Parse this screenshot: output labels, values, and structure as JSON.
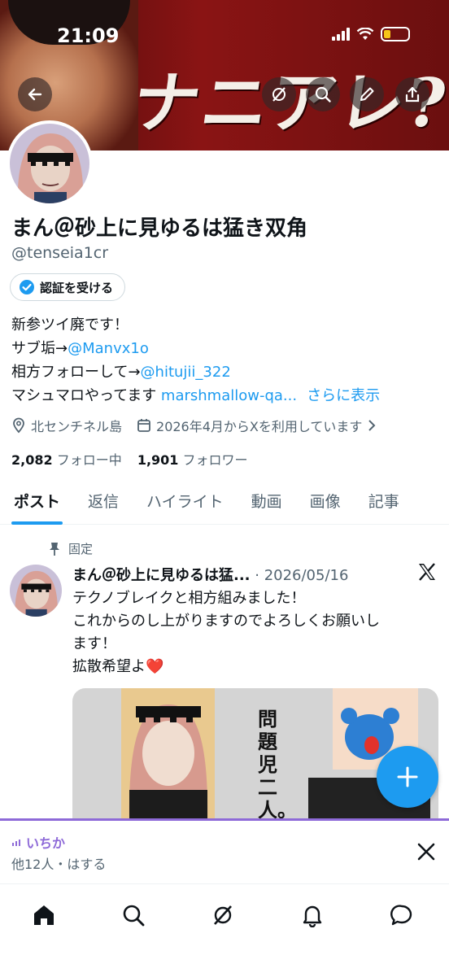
{
  "status_bar": {
    "time": "21:09"
  },
  "banner": {
    "text": "ナニアレ?"
  },
  "profile": {
    "name": "まん＠砂上に見ゆるは猛き双角",
    "handle": "@tenseia1cr",
    "verify_button": "認証を受ける",
    "bio": {
      "line1": "新参ツイ廃です！",
      "line2_prefix": "サブ垢→",
      "line2_link": "@Manvx1o",
      "line3_prefix": "相方フォローして→",
      "line3_link": "@hitujii_322",
      "line4_prefix": "マシュマロやってます ",
      "line4_link": "marshmallow-qa...",
      "show_more": "さらに表示"
    },
    "location": "北センチネル島",
    "joined": "2026年4月からXを利用しています",
    "following_count": "2,082",
    "following_label": "フォロー中",
    "followers_count": "1,901",
    "followers_label": "フォロワー"
  },
  "tabs": [
    "ポスト",
    "返信",
    "ハイライト",
    "動画",
    "画像",
    "記事"
  ],
  "post": {
    "pinned_label": "固定",
    "author": "まん＠砂上に見ゆるは猛...",
    "date": "2026/05/16",
    "line1": "テクノブレイクと相方組みました！",
    "line2": "これからのし上がりますのでよろしくお願いし",
    "line3": "ます！",
    "line4": "拡散希望よ❤️",
    "media_text": "問題児二人。"
  },
  "space": {
    "title": "いちか",
    "subtitle": "他12人・はする"
  },
  "colors": {
    "accent": "#1d9bf0",
    "space_purple": "#8e6ad8"
  }
}
